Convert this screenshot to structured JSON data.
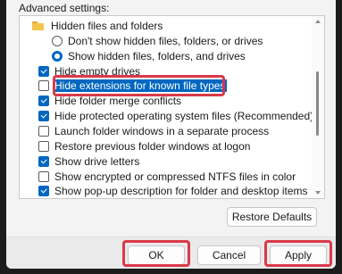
{
  "advanced_settings_label": "Advanced settings:",
  "tree": {
    "items": [
      {
        "kind": "folder",
        "label": "Hidden files and folders",
        "icon": "folder-icon"
      },
      {
        "kind": "radio",
        "checked": false,
        "label": "Don't show hidden files, folders, or drives"
      },
      {
        "kind": "radio",
        "checked": true,
        "label": "Show hidden files, folders, and drives"
      },
      {
        "kind": "checkbox",
        "checked": true,
        "label": "Hide empty drives"
      },
      {
        "kind": "checkbox",
        "checked": false,
        "label": "Hide extensions for known file types",
        "selected": true
      },
      {
        "kind": "checkbox",
        "checked": true,
        "label": "Hide folder merge conflicts"
      },
      {
        "kind": "checkbox",
        "checked": true,
        "label": "Hide protected operating system files (Recommended)"
      },
      {
        "kind": "checkbox",
        "checked": false,
        "label": "Launch folder windows in a separate process"
      },
      {
        "kind": "checkbox",
        "checked": false,
        "label": "Restore previous folder windows at logon"
      },
      {
        "kind": "checkbox",
        "checked": true,
        "label": "Show drive letters"
      },
      {
        "kind": "checkbox",
        "checked": false,
        "label": "Show encrypted or compressed NTFS files in color"
      },
      {
        "kind": "checkbox",
        "checked": true,
        "label": "Show pop-up description for folder and desktop items"
      }
    ]
  },
  "buttons": {
    "restore_defaults": "Restore Defaults",
    "ok": "OK",
    "cancel": "Cancel",
    "apply": "Apply"
  },
  "colors": {
    "accent": "#0067c0",
    "highlight_box": "#d93a4a",
    "dialog_background": "#f3f3f3",
    "outer_background": "#1c1c1c"
  }
}
